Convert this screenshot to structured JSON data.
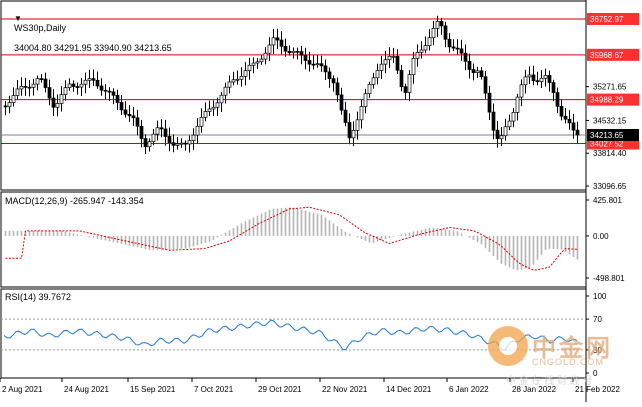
{
  "header": {
    "symbol": "WS30p,Daily",
    "ohlc": "34004.80 34291.95 33940.90 34213.65"
  },
  "main_panel": {
    "price_labels": [
      "35271.65",
      "34532.15",
      "33814.40",
      "33096.65"
    ],
    "horizontal_levels": [
      {
        "value": 36752.97,
        "label": "36752.97"
      },
      {
        "value": 35968.67,
        "label": "35968.67"
      },
      {
        "value": 34988.29,
        "label": "34988.29"
      },
      {
        "value": 34027.52,
        "label": "34027.52"
      }
    ],
    "current_price": {
      "value": 34213.65,
      "label": "34213.65"
    },
    "colors": {
      "level_line": "#d00000",
      "level_label_bg": "#ff3030",
      "bull_candle": "#ffffff",
      "bear_candle": "#000000"
    }
  },
  "macd_panel": {
    "title": "MACD(12,26,9) -265.947 -143.354",
    "axis_labels": [
      "425.801",
      "0.00",
      "-498.801"
    ],
    "colors": {
      "histogram": "#b4b4b4",
      "signal": "#d00000"
    }
  },
  "rsi_panel": {
    "title": "RSI(14) 39.7672",
    "axis_labels": [
      "100",
      "70",
      "30",
      "0"
    ],
    "colors": {
      "line": "#1e78d2"
    }
  },
  "time_axis": {
    "labels": [
      "2 Aug 2021",
      "24 Aug 2021",
      "15 Sep 2021",
      "7 Oct 2021",
      "29 Oct 2021",
      "22 Nov 2021",
      "14 Dec 2021",
      "6 Jan 2022",
      "28 Jan 2022",
      "21 Feb 2022"
    ]
  },
  "watermark": {
    "brand": "中金网",
    "url": "CNGOLD.COM",
    "slogan": "中 金 在 线 财 经 号"
  }
}
